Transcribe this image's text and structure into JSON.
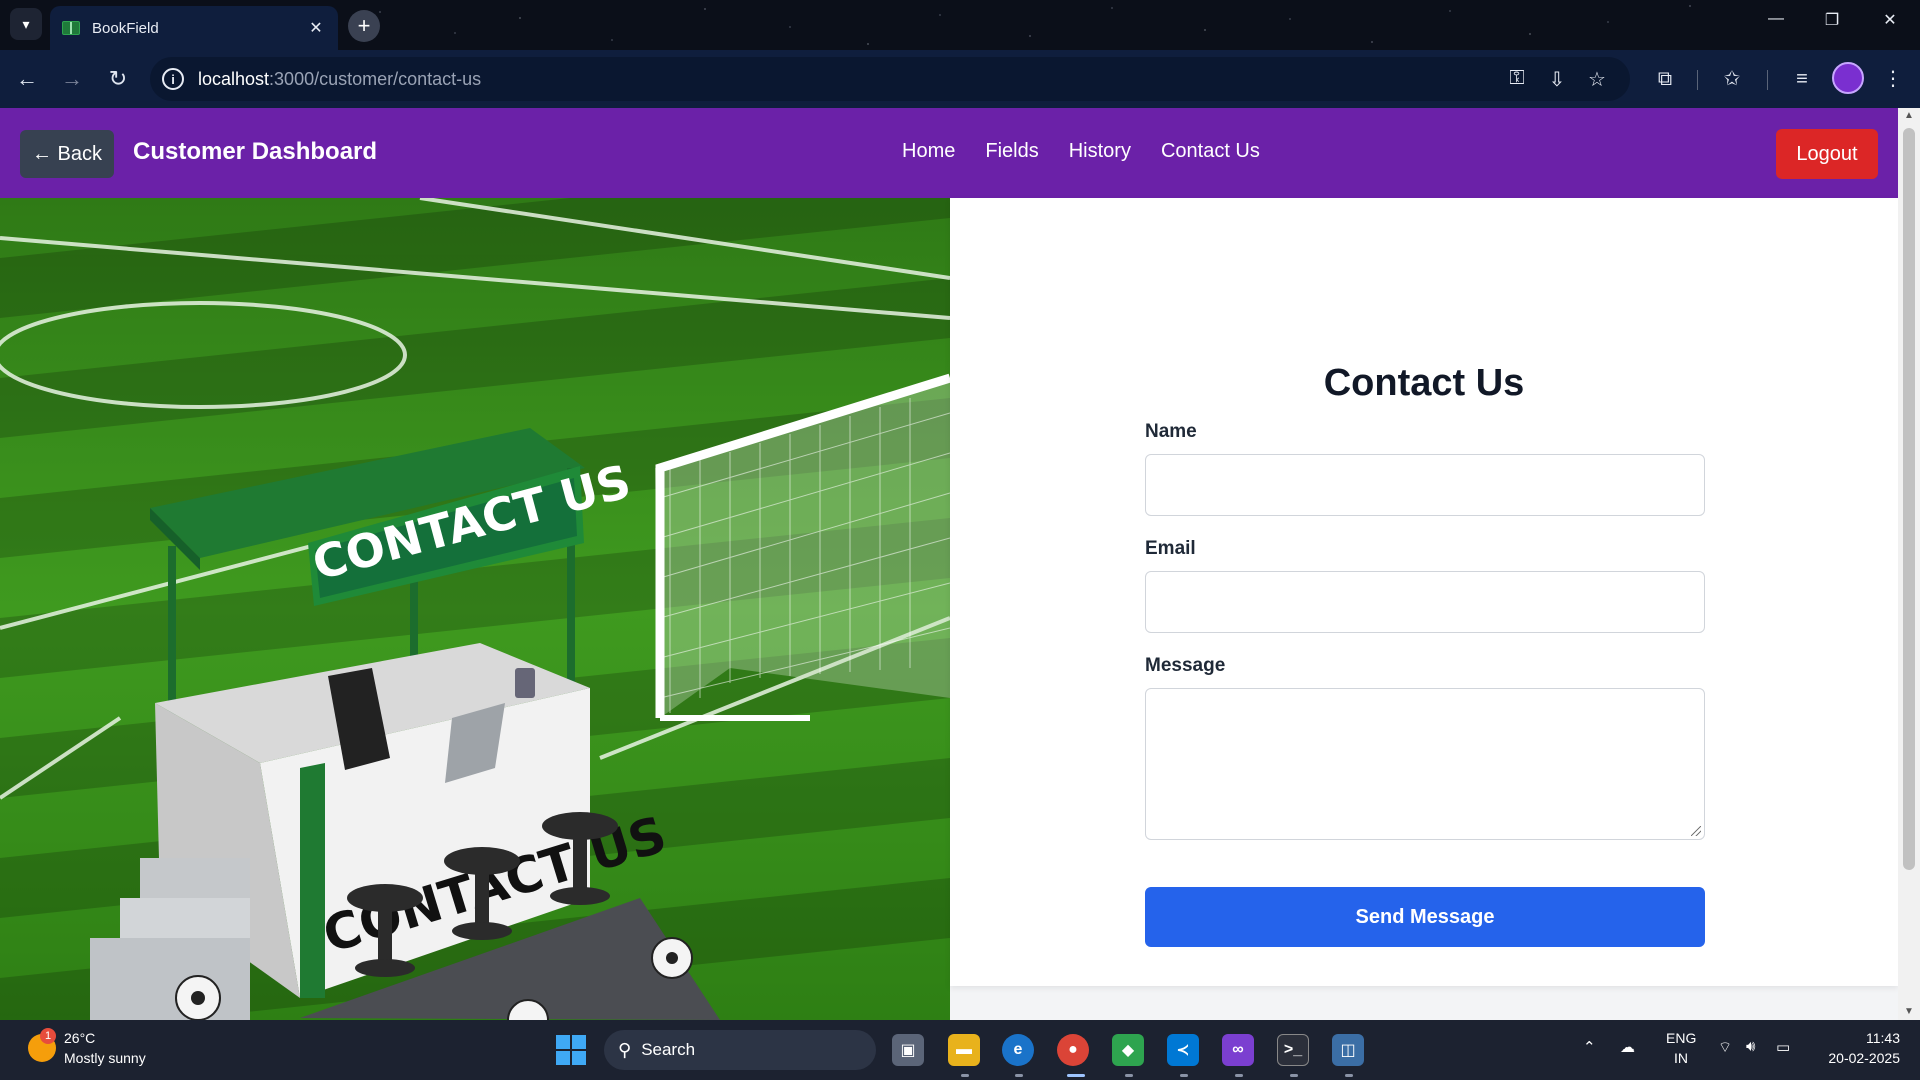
{
  "browser": {
    "tab_title": "BookField",
    "tab_close": "✕",
    "new_tab": "+",
    "url_host": "localhost",
    "url_rest": ":3000/customer/contact-us",
    "win_minimize": "—",
    "win_restore": "❐",
    "win_close": "✕"
  },
  "app": {
    "back_label": "← Back",
    "title": "Customer Dashboard",
    "nav": [
      "Home",
      "Fields",
      "History",
      "Contact Us"
    ],
    "logout_label": "Logout"
  },
  "hero": {
    "sign_top": "CONTACT US",
    "sign_front": "CONTACT US"
  },
  "contact": {
    "heading": "Contact Us",
    "name_label": "Name",
    "name_value": "",
    "email_label": "Email",
    "email_value": "",
    "message_label": "Message",
    "message_value": "",
    "submit_label": "Send Message"
  },
  "taskbar": {
    "weather_badge": "1",
    "temperature": "26°C",
    "weather": "Mostly sunny",
    "search_label": "Search",
    "lang_top": "ENG",
    "lang_bottom": "IN",
    "time": "11:43",
    "date": "20-02-2025"
  },
  "colors": {
    "nav_purple": "#6b21a8",
    "logout_red": "#dc2626",
    "back_gray": "#374151",
    "submit_blue": "#2563eb",
    "grass_green": "#3f8f1f"
  }
}
